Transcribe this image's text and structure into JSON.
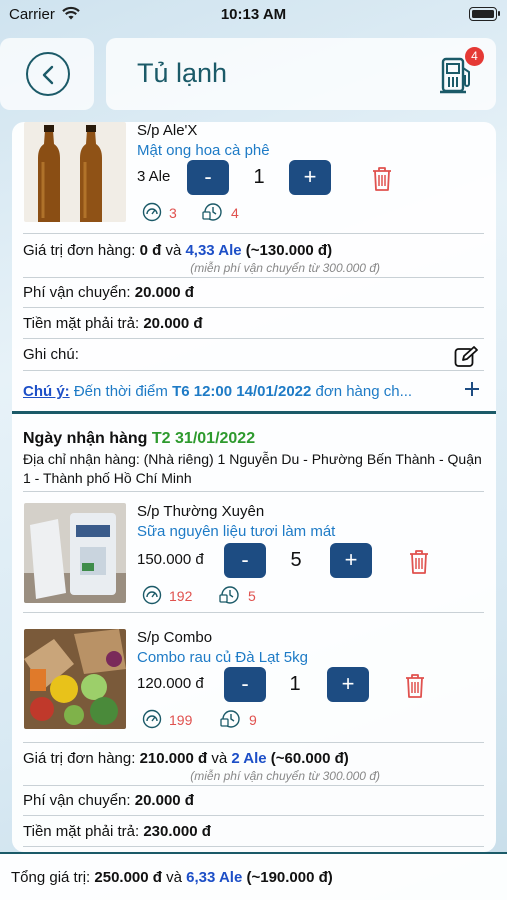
{
  "status_bar": {
    "carrier": "Carrier",
    "time": "10:13 AM"
  },
  "header": {
    "title": "Tủ lạnh",
    "cart_count": "4"
  },
  "order1": {
    "product": {
      "type": "S/p Ale'X",
      "name": "Mật ong hoa cà phê",
      "price": "3 Ale",
      "qty": "1",
      "stat_a": "3",
      "stat_b": "4"
    },
    "value_label": "Giá trị đơn hàng:",
    "value_amount": "0 đ",
    "value_and": "và",
    "value_ale": "4,33 Ale",
    "value_approx": "(~130.000 đ)",
    "free_ship_note": "(miễn phí vận chuyển từ 300.000 đ)",
    "shipping_label": "Phí vận chuyển:",
    "shipping_value": "20.000 đ",
    "cash_label": "Tiền mặt phải trả:",
    "cash_value": "20.000 đ",
    "note_label": "Ghi chú:",
    "attention_label": "Chú ý:",
    "attention_prefix": "Đến thời điểm",
    "attention_time": "T6 12:00 14/01/2022",
    "attention_suffix": "đơn hàng ch..."
  },
  "order2": {
    "date_label": "Ngày nhận hàng",
    "date_value": "T2 31/01/2022",
    "address": "Địa chỉ nhận hàng: (Nhà riêng) 1 Nguyễn Du - Phường Bến Thành - Quận 1 - Thành phố Hồ Chí Minh",
    "products": [
      {
        "type": "S/p Thường Xuyên",
        "name": "Sữa nguyên liệu tươi làm mát",
        "price": "150.000 đ",
        "qty": "5",
        "stat_a": "192",
        "stat_b": "5"
      },
      {
        "type": "S/p Combo",
        "name": "Combo rau củ Đà Lạt 5kg",
        "price": "120.000 đ",
        "qty": "1",
        "stat_a": "199",
        "stat_b": "9"
      }
    ],
    "value_label": "Giá trị đơn hàng:",
    "value_amount": "210.000 đ",
    "value_and": "và",
    "value_ale": "2 Ale",
    "value_approx": "(~60.000 đ)",
    "free_ship_note": "(miễn phí vận chuyển từ 300.000 đ)",
    "shipping_label": "Phí vận chuyển:",
    "shipping_value": "20.000 đ",
    "cash_label": "Tiền mặt phải trả:",
    "cash_value": "230.000 đ"
  },
  "buttons": {
    "minus": "-",
    "plus": "+"
  },
  "footer": {
    "label": "Tổng giá trị:",
    "amount": "250.000 đ",
    "and": "và",
    "ale": "6,33 Ale",
    "approx": "(~190.000 đ)"
  },
  "icons": {
    "back": "chevron-left-icon",
    "cart": "gas-pump-cart-icon",
    "trash": "trash-icon",
    "edit": "edit-note-icon",
    "add": "plus-icon",
    "stat_a": "gauge-icon",
    "stat_b": "clock-lock-icon"
  },
  "colors": {
    "primary": "#1b5a68",
    "button": "#1d4c82",
    "link": "#1e7bc6",
    "ale": "#1d4fc7",
    "date": "#2e9a2e",
    "danger": "#e0524f",
    "badge": "#e53935"
  }
}
